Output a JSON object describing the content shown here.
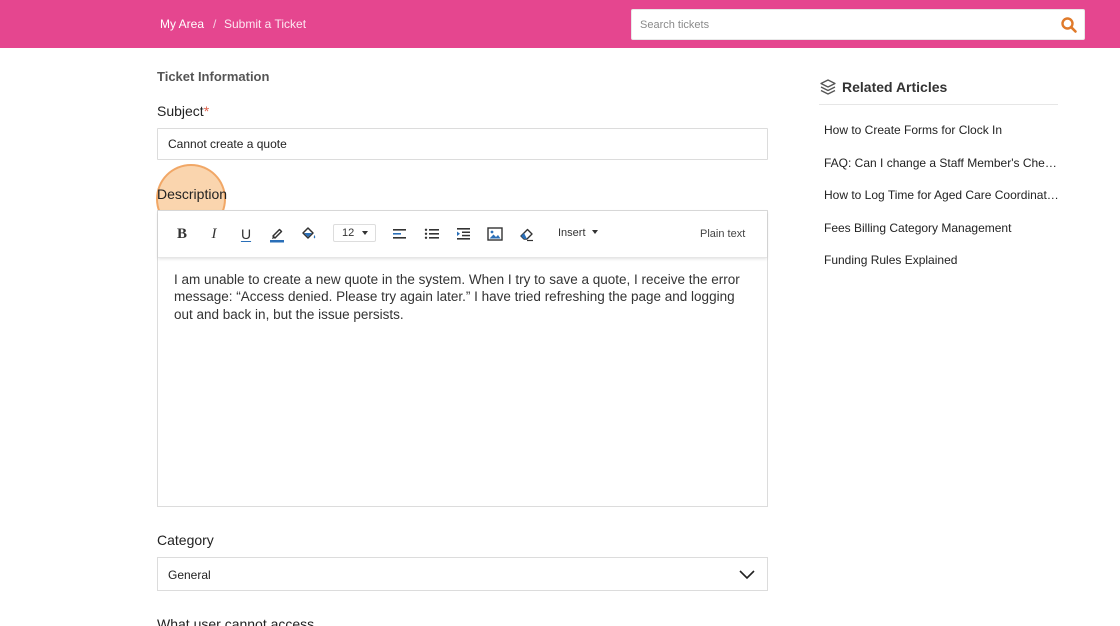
{
  "breadcrumb": {
    "home": "My Area",
    "separator": "/",
    "current": "Submit a Ticket"
  },
  "search": {
    "placeholder": "Search tickets",
    "value": "",
    "icon": "search-icon"
  },
  "form": {
    "section_title": "Ticket Information",
    "subject": {
      "label": "Subject",
      "required_mark": "*",
      "value": "Cannot create a quote"
    },
    "description": {
      "label": "Description",
      "toolbar": {
        "font_size": "12",
        "insert_label": "Insert",
        "plain_text_label": "Plain text",
        "icons": [
          "bold-icon",
          "italic-icon",
          "underline-icon",
          "highlighter-icon",
          "fill-color-icon",
          "align-left-icon",
          "bullet-list-icon",
          "indent-icon",
          "image-icon",
          "eraser-icon"
        ],
        "bold_glyph": "B",
        "italic_glyph": "I",
        "underline_glyph": "U"
      },
      "body": "I am unable to create a new quote in the system. When I try to save a quote, I receive the error message: “Access denied. Please try again later.” I have tried refreshing the page and logging out and back in, but the issue persists."
    },
    "category": {
      "label": "Category",
      "value": "General"
    },
    "next_field_label": "What user cannot access"
  },
  "related": {
    "title": "Related Articles",
    "icon": "layers-icon",
    "articles": [
      "How to Create Forms for Clock In",
      "FAQ: Can I change a Staff Member's Check In",
      "How to Log Time for Aged Care Coordination",
      "Fees Billing Category Management",
      "Funding Rules Explained"
    ]
  },
  "colors": {
    "brand": "#e5468f",
    "search_icon": "#e07a2a",
    "required": "#e0604b",
    "click_highlight": "#f6b26b"
  }
}
